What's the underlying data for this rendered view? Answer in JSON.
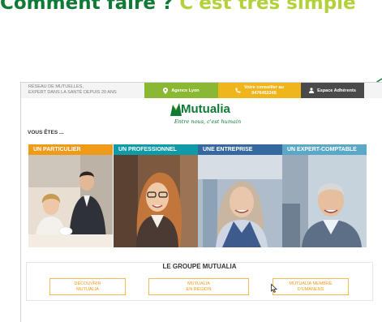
{
  "slide": {
    "title_main": "Comment faire ?",
    "title_accent": "C'est très simple"
  },
  "topbar": {
    "tagline_line1": "RÉSEAU DE MUTUELLES,",
    "tagline_line2": "EXPERT DANS LA SANTÉ DEPUIS 20 ANS",
    "agence_label": "Agence Lyon",
    "phone_label": "Votre conseiller au",
    "phone_number": "0476452245",
    "espace_label": "Espace Adhérents"
  },
  "logo": {
    "name": "Mutualia",
    "slogan": "Entre nous, c'est humain"
  },
  "profiles": {
    "heading": "VOUS ÊTES ...",
    "items": [
      {
        "label": "UN PARTICULIER",
        "color": "#f09a1a"
      },
      {
        "label": "UN PROFESSIONNEL",
        "color": "#0e9aa7"
      },
      {
        "label": "UNE ENTREPRISE",
        "color": "#35689f"
      },
      {
        "label": "UN EXPERT-COMPTABLE",
        "color": "#5aa7c7"
      }
    ]
  },
  "groupe": {
    "title": "LE GROUPE MUTUALIA",
    "buttons": [
      {
        "line1": "DÉCOUVRIR",
        "line2": "MUTUALIA"
      },
      {
        "line1": "MUTUALIA",
        "line2": "EN RÉGION"
      },
      {
        "line1": "MUTUALIA MEMBRE",
        "line2": "D'UMANENS"
      }
    ]
  },
  "colors": {
    "title_green": "#0e7a33",
    "title_lime": "#b3d13b",
    "agence_green": "#8ab833",
    "phone_yellow": "#f1b51c",
    "espace_dark": "#4a4a4a",
    "button_orange": "#f39a1a"
  },
  "icons": [
    "location-pin-icon",
    "phone-icon",
    "user-icon",
    "mutualia-logo-icon",
    "mouse-cursor-icon"
  ]
}
